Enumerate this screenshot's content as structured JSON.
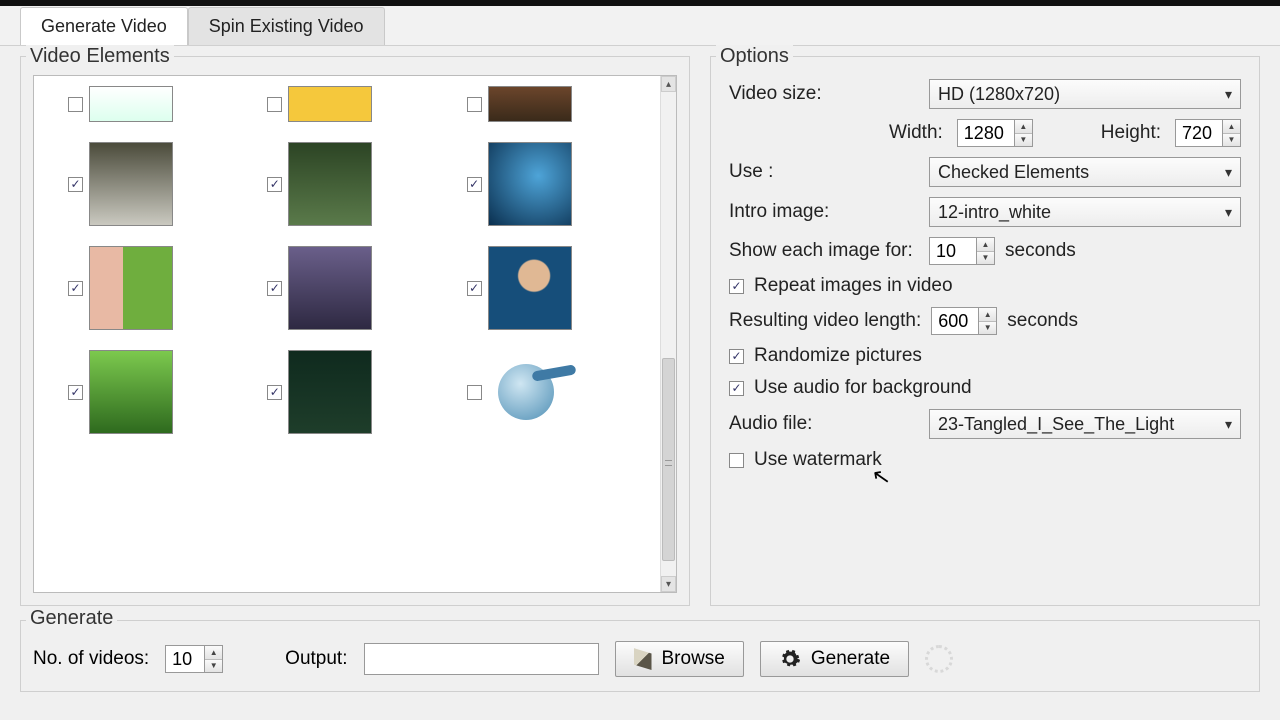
{
  "tabs": {
    "generate": "Generate Video",
    "spin": "Spin Existing Video"
  },
  "sections": {
    "elements": "Video Elements",
    "options": "Options",
    "generate": "Generate"
  },
  "thumbs": [
    {
      "checked": false,
      "cls": "t0"
    },
    {
      "checked": false,
      "cls": "t1"
    },
    {
      "checked": false,
      "cls": "t2"
    },
    {
      "checked": true,
      "cls": "t3"
    },
    {
      "checked": true,
      "cls": "t4"
    },
    {
      "checked": true,
      "cls": "t5"
    },
    {
      "checked": true,
      "cls": "t6"
    },
    {
      "checked": true,
      "cls": "t7"
    },
    {
      "checked": true,
      "cls": "t8"
    },
    {
      "checked": true,
      "cls": "t9"
    },
    {
      "checked": true,
      "cls": "t10"
    },
    {
      "checked": false,
      "cls": "audio"
    }
  ],
  "options": {
    "video_size_label": "Video size:",
    "video_size_value": "HD (1280x720)",
    "width_label": "Width:",
    "width_value": "1280",
    "height_label": "Height:",
    "height_value": "720",
    "use_label": "Use :",
    "use_value": "Checked Elements",
    "intro_label": "Intro image:",
    "intro_value": "12-intro_white",
    "show_each_label": "Show each image for:",
    "show_each_value": "10",
    "seconds": "seconds",
    "repeat_label": "Repeat images in video",
    "repeat_checked": true,
    "result_len_label": "Resulting video length:",
    "result_len_value": "600",
    "randomize_label": "Randomize pictures",
    "randomize_checked": true,
    "use_audio_label": "Use audio for background",
    "use_audio_checked": true,
    "audio_file_label": "Audio file:",
    "audio_file_value": "23-Tangled_I_See_The_Light",
    "watermark_label": "Use watermark",
    "watermark_checked": false
  },
  "generate": {
    "num_label": "No. of videos:",
    "num_value": "10",
    "output_label": "Output:",
    "browse": "Browse",
    "generate": "Generate"
  }
}
